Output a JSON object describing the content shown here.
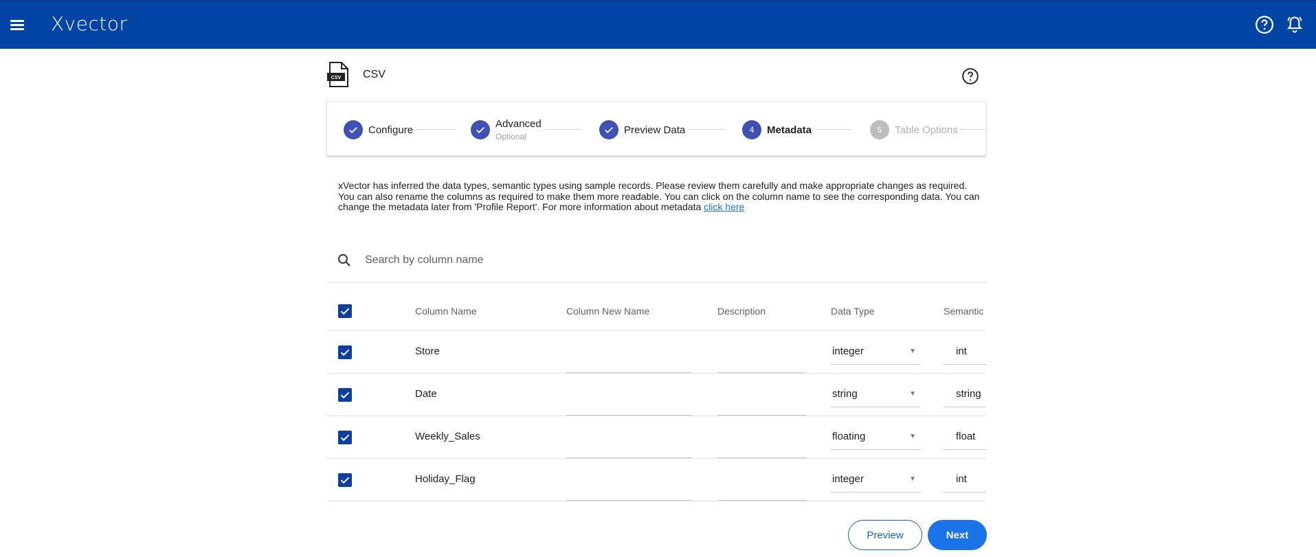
{
  "topbar": {
    "logo": "Xvector",
    "icons": [
      "menu-icon",
      "help-icon",
      "notifications-icon"
    ],
    "bg_color": "#0044a5"
  },
  "header": {
    "title": "CSV",
    "file_icon_label": "CSV"
  },
  "stepper": {
    "steps": [
      {
        "index": "1",
        "label": "Configure",
        "sub": "",
        "state": "done"
      },
      {
        "index": "2",
        "label": "Advanced",
        "sub": "Optional",
        "state": "done"
      },
      {
        "index": "3",
        "label": "Preview Data",
        "sub": "",
        "state": "done"
      },
      {
        "index": "4",
        "label": "Metadata",
        "sub": "",
        "state": "active"
      },
      {
        "index": "5",
        "label": "Table Options",
        "sub": "",
        "state": "disabled"
      }
    ]
  },
  "info": {
    "text": "xVector has inferred the data types, semantic types using sample records. Please review them carefully and make appropriate changes as required. You can also rename the columns as required to make them more readable. You can click on the column name to see the corresponding data. You can change the metadata later from 'Profile Report'. For more information about metadata ",
    "link_text": "click here"
  },
  "search": {
    "placeholder": "Search by column name"
  },
  "table": {
    "headers": {
      "column_name": "Column Name",
      "column_new_name": "Column New Name",
      "description": "Description",
      "data_type": "Data Type",
      "semantic": "Semantic"
    },
    "rows": [
      {
        "name": "Store",
        "data_type": "integer",
        "semantic": "int"
      },
      {
        "name": "Date",
        "data_type": "string",
        "semantic": "string"
      },
      {
        "name": "Weekly_Sales",
        "data_type": "floating",
        "semantic": "float"
      },
      {
        "name": "Holiday_Flag",
        "data_type": "integer",
        "semantic": "int"
      }
    ]
  },
  "actions": {
    "preview_label": "Preview",
    "next_label": "Next"
  }
}
